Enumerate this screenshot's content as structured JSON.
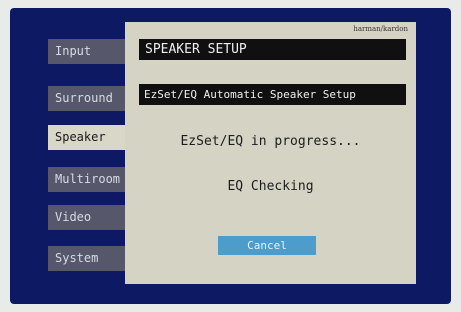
{
  "menu": {
    "items": [
      {
        "label": "Input"
      },
      {
        "label": "Surround"
      },
      {
        "label": "Speaker"
      },
      {
        "label": "Multiroom"
      },
      {
        "label": "Video"
      },
      {
        "label": "System"
      }
    ],
    "active_index": 2
  },
  "dialog": {
    "brand": "harman/kardon",
    "title": "SPEAKER SETUP",
    "subtitle": "EzSet/EQ Automatic Speaker Setup",
    "progress_text": "EzSet/EQ in progress...",
    "status_text": "EQ Checking",
    "cancel_label": "Cancel"
  },
  "colors": {
    "screen_bg": "#0d1a63",
    "menu_bg": "#56576b",
    "menu_active_bg": "#d9d7c7",
    "dialog_bg": "#d5d3c4",
    "cancel_bg": "#4c9ccc"
  }
}
